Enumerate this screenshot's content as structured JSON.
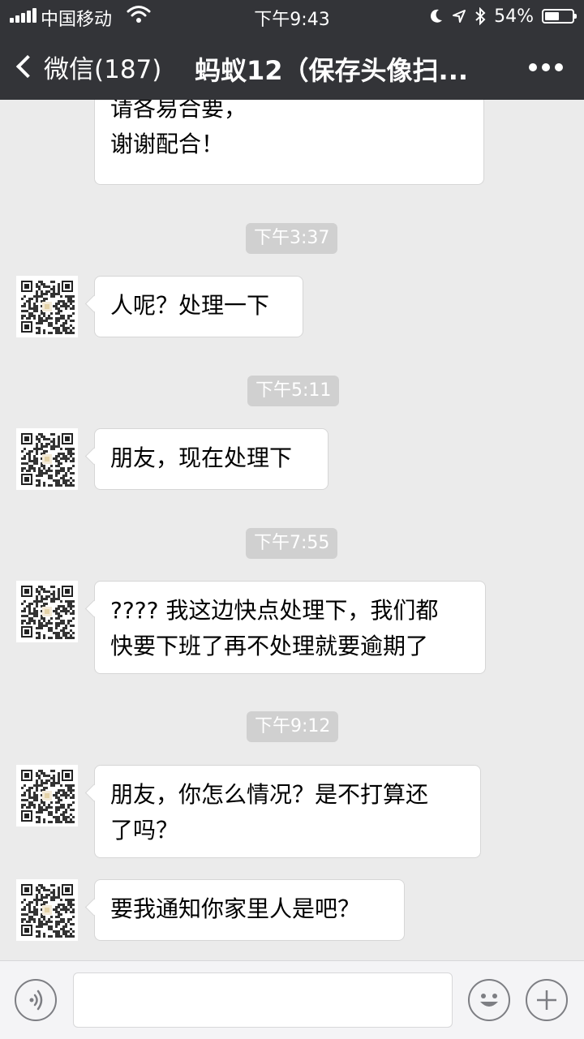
{
  "status_bar": {
    "carrier": "中国移动",
    "time": "下午9:43",
    "battery_percent": "54%",
    "battery_level": 0.54,
    "icons": [
      "signal-icon",
      "wifi-icon",
      "moon-icon",
      "location-icon",
      "bluetooth-icon",
      "battery-icon"
    ]
  },
  "nav": {
    "back_label": "微信(187)",
    "title": "蚂蚁12（保存头像扫...",
    "more_icon": "more-icon"
  },
  "messages": [
    {
      "type": "partial",
      "lines": [
        "请各易合要，",
        "谢谢配合！"
      ]
    },
    {
      "type": "time",
      "text": "下午3:37"
    },
    {
      "type": "msg",
      "lines": [
        "人呢？处理一下"
      ]
    },
    {
      "type": "time",
      "text": "下午5:11"
    },
    {
      "type": "msg",
      "lines": [
        "朋友，现在处理下"
      ]
    },
    {
      "type": "time",
      "text": "下午7:55"
    },
    {
      "type": "msg",
      "lines": [
        "???? 我这边快点处理下，我们都",
        "快要下班了再不处理就要逾期了"
      ]
    },
    {
      "type": "time",
      "text": "下午9:12"
    },
    {
      "type": "msg",
      "lines": [
        "朋友，你怎么情况？是不打算还",
        "了吗？"
      ]
    },
    {
      "type": "msg",
      "lines": [
        "要我通知你家里人是吧？"
      ]
    }
  ],
  "input_bar": {
    "input_value": "",
    "voice_icon": "voice-icon",
    "emoji_icon": "emoji-icon",
    "plus_icon": "plus-icon"
  },
  "colors": {
    "header_bg": "#333438",
    "chat_bg": "#ebebeb",
    "bubble_bg": "#ffffff",
    "timestamp_bg": "#d0d0d0",
    "input_bar_bg": "#f4f4f6"
  }
}
